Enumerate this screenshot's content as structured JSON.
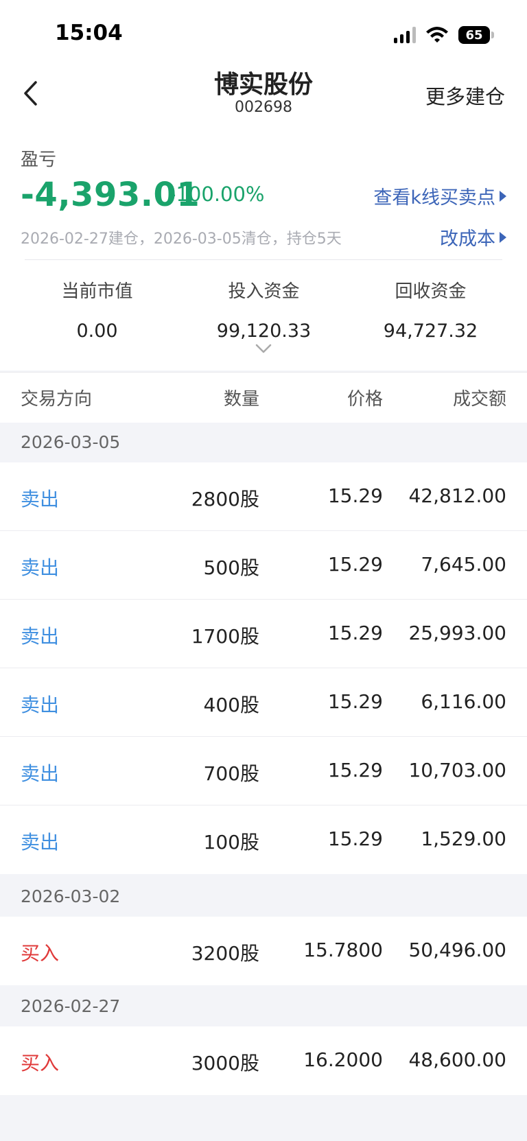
{
  "status": {
    "time": "15:04",
    "battery": "65"
  },
  "header": {
    "title": "博实股份",
    "code": "002698",
    "more": "更多建仓"
  },
  "pnl": {
    "label": "盈亏",
    "value": "-4,393.01",
    "percent": "-100.00%",
    "kline_link": "查看k线买卖点",
    "hold_info": "2026-02-27建仓，2026-03-05清仓，持仓5天",
    "cost_link": "改成本"
  },
  "stats": [
    {
      "label": "当前市值",
      "value": "0.00"
    },
    {
      "label": "投入资金",
      "value": "99,120.33"
    },
    {
      "label": "回收资金",
      "value": "94,727.32"
    }
  ],
  "table": {
    "headers": {
      "direction": "交易方向",
      "quantity": "数量",
      "price": "价格",
      "amount": "成交额"
    },
    "groups": [
      {
        "date": "2026-03-05",
        "rows": [
          {
            "direction": "卖出",
            "quantity": "2800股",
            "price": "15.29",
            "amount": "42,812.00"
          },
          {
            "direction": "卖出",
            "quantity": "500股",
            "price": "15.29",
            "amount": "7,645.00"
          },
          {
            "direction": "卖出",
            "quantity": "1700股",
            "price": "15.29",
            "amount": "25,993.00"
          },
          {
            "direction": "卖出",
            "quantity": "400股",
            "price": "15.29",
            "amount": "6,116.00"
          },
          {
            "direction": "卖出",
            "quantity": "700股",
            "price": "15.29",
            "amount": "10,703.00"
          },
          {
            "direction": "卖出",
            "quantity": "100股",
            "price": "15.29",
            "amount": "1,529.00"
          }
        ]
      },
      {
        "date": "2026-03-02",
        "rows": [
          {
            "direction": "买入",
            "quantity": "3200股",
            "price": "15.7800",
            "amount": "50,496.00"
          }
        ]
      },
      {
        "date": "2026-02-27",
        "rows": [
          {
            "direction": "买入",
            "quantity": "3000股",
            "price": "16.2000",
            "amount": "48,600.00"
          }
        ]
      }
    ]
  },
  "colors": {
    "loss_green": "#1aa36b",
    "link_blue": "#3c65b8",
    "sell_blue": "#3f8fe0",
    "buy_red": "#e03a3a"
  }
}
